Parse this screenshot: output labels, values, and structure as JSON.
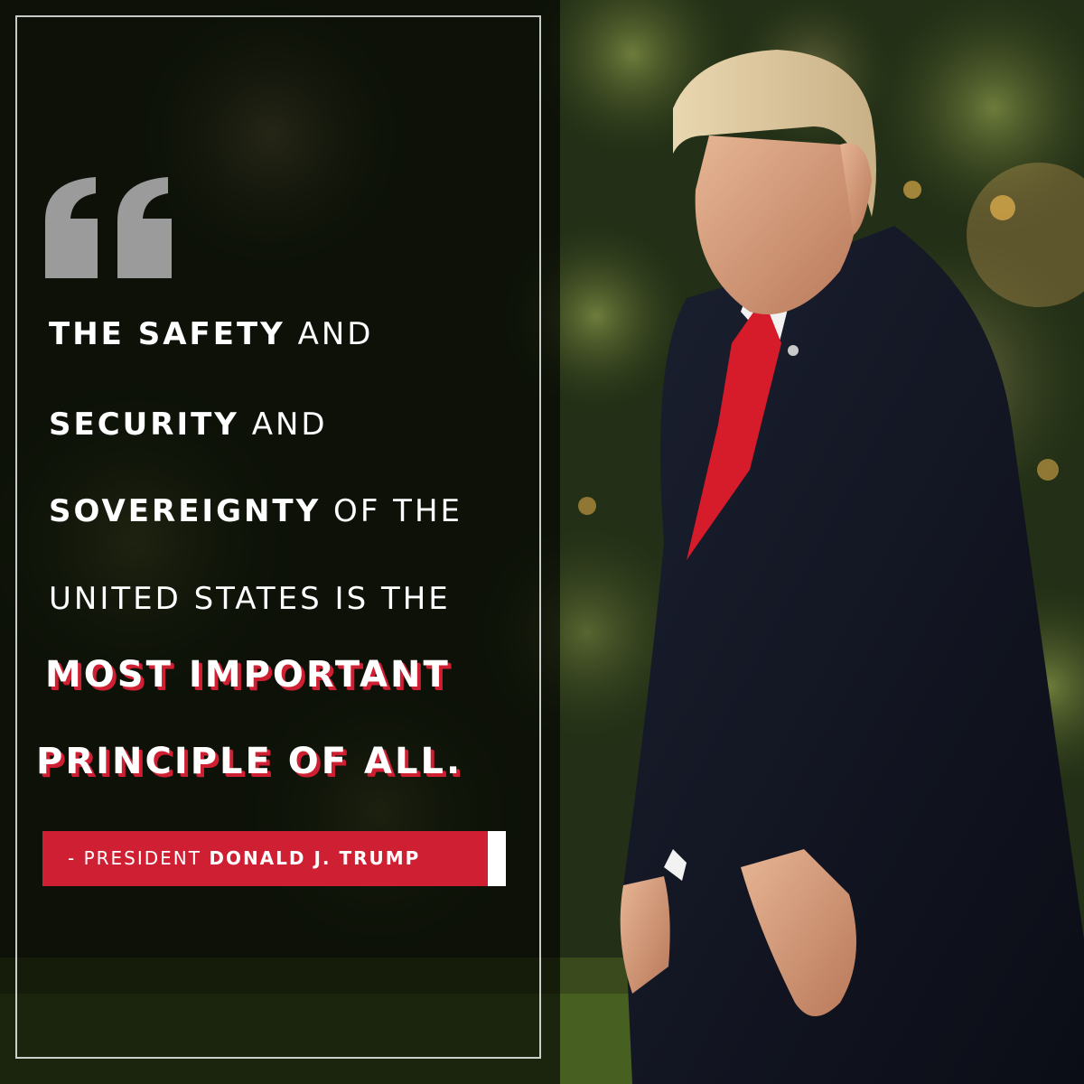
{
  "quote": {
    "line1_bold": "THE SAFETY",
    "line1_rest": " AND",
    "line2_bold": "SECURITY",
    "line2_rest": " AND",
    "line3_bold": "SOVEREIGNTY",
    "line3_rest": " OF THE",
    "line4": "UNITED STATES IS THE",
    "line5": "MOST IMPORTANT",
    "line6": "PRINCIPLE OF ALL."
  },
  "attribution": {
    "prefix": "- PRESIDENT ",
    "name": "DONALD J. TRUMP"
  },
  "colors": {
    "accent": "#cf1f33",
    "text": "#ffffff",
    "quote_mark": "#9b9b9b"
  },
  "icons": {
    "quote": "open-quote-icon",
    "photo": "person-photo"
  }
}
